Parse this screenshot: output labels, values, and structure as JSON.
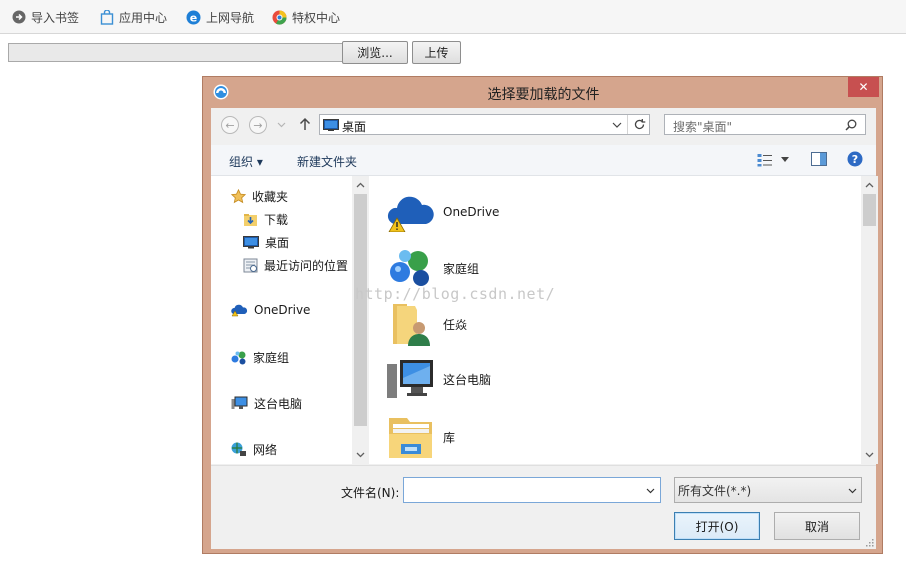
{
  "bookmarks": [
    {
      "label": "导入书签",
      "icon": "import-bookmark-icon"
    },
    {
      "label": "应用中心",
      "icon": "shopping-bag-icon"
    },
    {
      "label": "上网导航",
      "icon": "ie-logo-icon"
    },
    {
      "label": "特权中心",
      "icon": "privilege-icon"
    }
  ],
  "page": {
    "browse_label": "浏览...",
    "upload_label": "上传"
  },
  "dialog": {
    "title": "选择要加载的文件",
    "close_glyph": "✕",
    "address": {
      "location": "桌面"
    },
    "search": {
      "placeholder": "搜索\"桌面\""
    },
    "toolbar": {
      "organize": "组织 ▾",
      "new_folder": "新建文件夹"
    },
    "nav": {
      "favorites": "收藏夹",
      "downloads": "下载",
      "desktop": "桌面",
      "recent": "最近访问的位置",
      "onedrive": "OneDrive",
      "homegroup": "家庭组",
      "this_pc": "这台电脑",
      "network": "网络"
    },
    "items": [
      {
        "label": "OneDrive",
        "icon": "onedrive-icon"
      },
      {
        "label": "家庭组",
        "icon": "homegroup-icon"
      },
      {
        "label": "任焱",
        "icon": "user-folder-icon"
      },
      {
        "label": "这台电脑",
        "icon": "computer-icon"
      },
      {
        "label": "库",
        "icon": "library-icon"
      }
    ],
    "footer": {
      "filename_label": "文件名(N):",
      "filename_value": "",
      "filetype": "所有文件(*.*)",
      "open_label": "打开(O)",
      "cancel_label": "取消"
    }
  },
  "watermark": "http://blog.csdn.net/",
  "colors": {
    "title_bar": "#d5a58d",
    "close": "#c75050",
    "accent": "#1e395b"
  }
}
